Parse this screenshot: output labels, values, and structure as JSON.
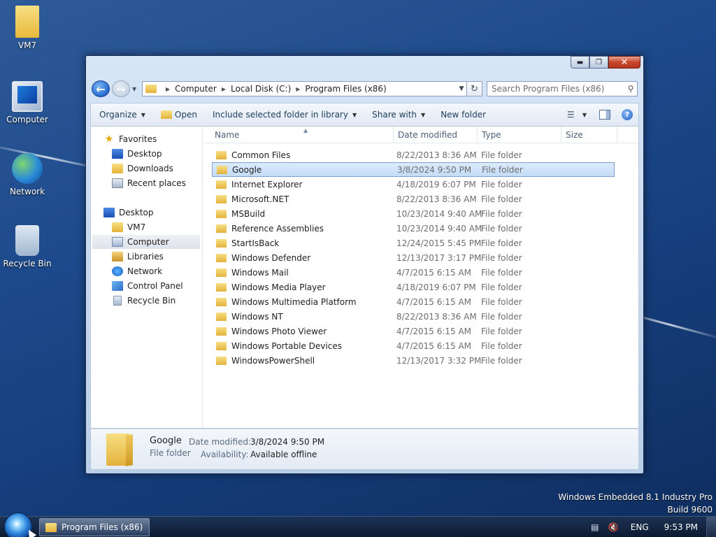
{
  "desktop": {
    "icons": [
      {
        "label": "VM7",
        "icon": "user-folder-icon"
      },
      {
        "label": "Computer",
        "icon": "computer-icon"
      },
      {
        "label": "Network",
        "icon": "network-icon"
      },
      {
        "label": "Recycle Bin",
        "icon": "recycle-bin-icon"
      }
    ],
    "watermark": {
      "line1": "Windows Embedded 8.1 Industry Pro",
      "line2": "Build 9600"
    }
  },
  "window": {
    "caption_buttons": {
      "minimize": "minimize-icon",
      "maximize": "maximize-icon",
      "close": "close-icon"
    },
    "address": {
      "crumbs": [
        "Computer",
        "Local Disk (C:)",
        "Program Files (x86)"
      ]
    },
    "search": {
      "placeholder": "Search Program Files (x86)"
    },
    "toolbar": {
      "organize": "Organize",
      "open": "Open",
      "include": "Include selected folder in library",
      "share": "Share with",
      "new_folder": "New folder"
    },
    "navpane": {
      "favorites": "Favorites",
      "fav_desktop": "Desktop",
      "fav_downloads": "Downloads",
      "fav_recent": "Recent places",
      "desktop": "Desktop",
      "vm7": "VM7",
      "computer": "Computer",
      "libraries": "Libraries",
      "network": "Network",
      "control_panel": "Control Panel",
      "recycle_bin": "Recycle Bin"
    },
    "columns": {
      "name": "Name",
      "date": "Date modified",
      "type": "Type",
      "size": "Size"
    },
    "files": [
      {
        "name": "Common Files",
        "date": "8/22/2013 8:36 AM",
        "type": "File folder"
      },
      {
        "name": "Google",
        "date": "3/8/2024 9:50 PM",
        "type": "File folder"
      },
      {
        "name": "Internet Explorer",
        "date": "4/18/2019 6:07 PM",
        "type": "File folder"
      },
      {
        "name": "Microsoft.NET",
        "date": "8/22/2013 8:36 AM",
        "type": "File folder"
      },
      {
        "name": "MSBuild",
        "date": "10/23/2014 9:40 AM",
        "type": "File folder"
      },
      {
        "name": "Reference Assemblies",
        "date": "10/23/2014 9:40 AM",
        "type": "File folder"
      },
      {
        "name": "StartIsBack",
        "date": "12/24/2015 5:45 PM",
        "type": "File folder"
      },
      {
        "name": "Windows Defender",
        "date": "12/13/2017 3:17 PM",
        "type": "File folder"
      },
      {
        "name": "Windows Mail",
        "date": "4/7/2015 6:15 AM",
        "type": "File folder"
      },
      {
        "name": "Windows Media Player",
        "date": "4/18/2019 6:07 PM",
        "type": "File folder"
      },
      {
        "name": "Windows Multimedia Platform",
        "date": "4/7/2015 6:15 AM",
        "type": "File folder"
      },
      {
        "name": "Windows NT",
        "date": "8/22/2013 8:36 AM",
        "type": "File folder"
      },
      {
        "name": "Windows Photo Viewer",
        "date": "4/7/2015 6:15 AM",
        "type": "File folder"
      },
      {
        "name": "Windows Portable Devices",
        "date": "4/7/2015 6:15 AM",
        "type": "File folder"
      },
      {
        "name": "WindowsPowerShell",
        "date": "12/13/2017 3:32 PM",
        "type": "File folder"
      }
    ],
    "selected_index": 1,
    "details": {
      "name": "Google",
      "type": "File folder",
      "date_label": "Date modified:",
      "date_value": "3/8/2024 9:50 PM",
      "avail_label": "Availability:",
      "avail_value": "Available offline"
    }
  },
  "taskbar": {
    "task_label": "Program Files (x86)",
    "language": "ENG",
    "time": "9:53 PM"
  }
}
